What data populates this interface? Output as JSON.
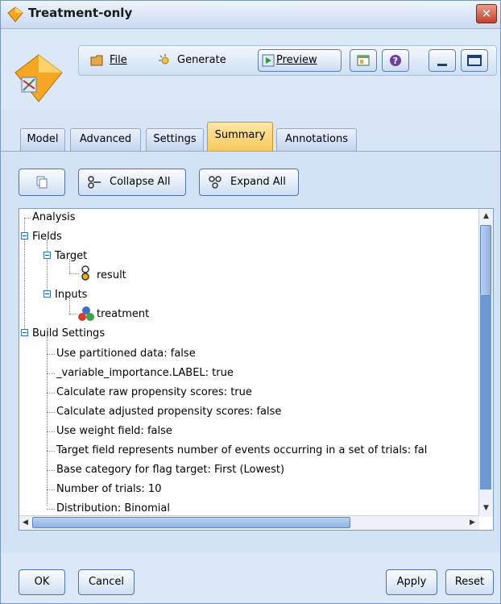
{
  "window": {
    "title": "Treatment-only"
  },
  "toolbar": {
    "file_label": "File",
    "generate_label": "Generate",
    "preview_label": "Preview"
  },
  "tabs": [
    {
      "label": "Model"
    },
    {
      "label": "Advanced"
    },
    {
      "label": "Settings"
    },
    {
      "label": "Summary",
      "active": true
    },
    {
      "label": "Annotations"
    }
  ],
  "summary": {
    "collapse_label": "Collapse All",
    "expand_label": "Expand All",
    "tree": {
      "analysis": "Analysis",
      "fields": "Fields",
      "target": "Target",
      "result": "result",
      "inputs": "Inputs",
      "treatment": "treatment",
      "build_settings": "Build Settings",
      "settings": [
        "Use partitioned data: false",
        "_variable_importance.LABEL: true",
        "Calculate raw propensity scores: true",
        "Calculate adjusted propensity scores: false",
        "Use weight field: false",
        "Target field represents number of events occurring in a set of trials: fal",
        "Base category for flag target: First (Lowest)",
        "Number of trials: 10",
        "Distribution: Binomial"
      ]
    }
  },
  "footer": {
    "ok_label": "OK",
    "cancel_label": "Cancel",
    "apply_label": "Apply",
    "reset_label": "Reset"
  },
  "colors": {
    "active_tab": "#f6c85b",
    "accent": "#4d73aa",
    "close": "#c2412a"
  }
}
